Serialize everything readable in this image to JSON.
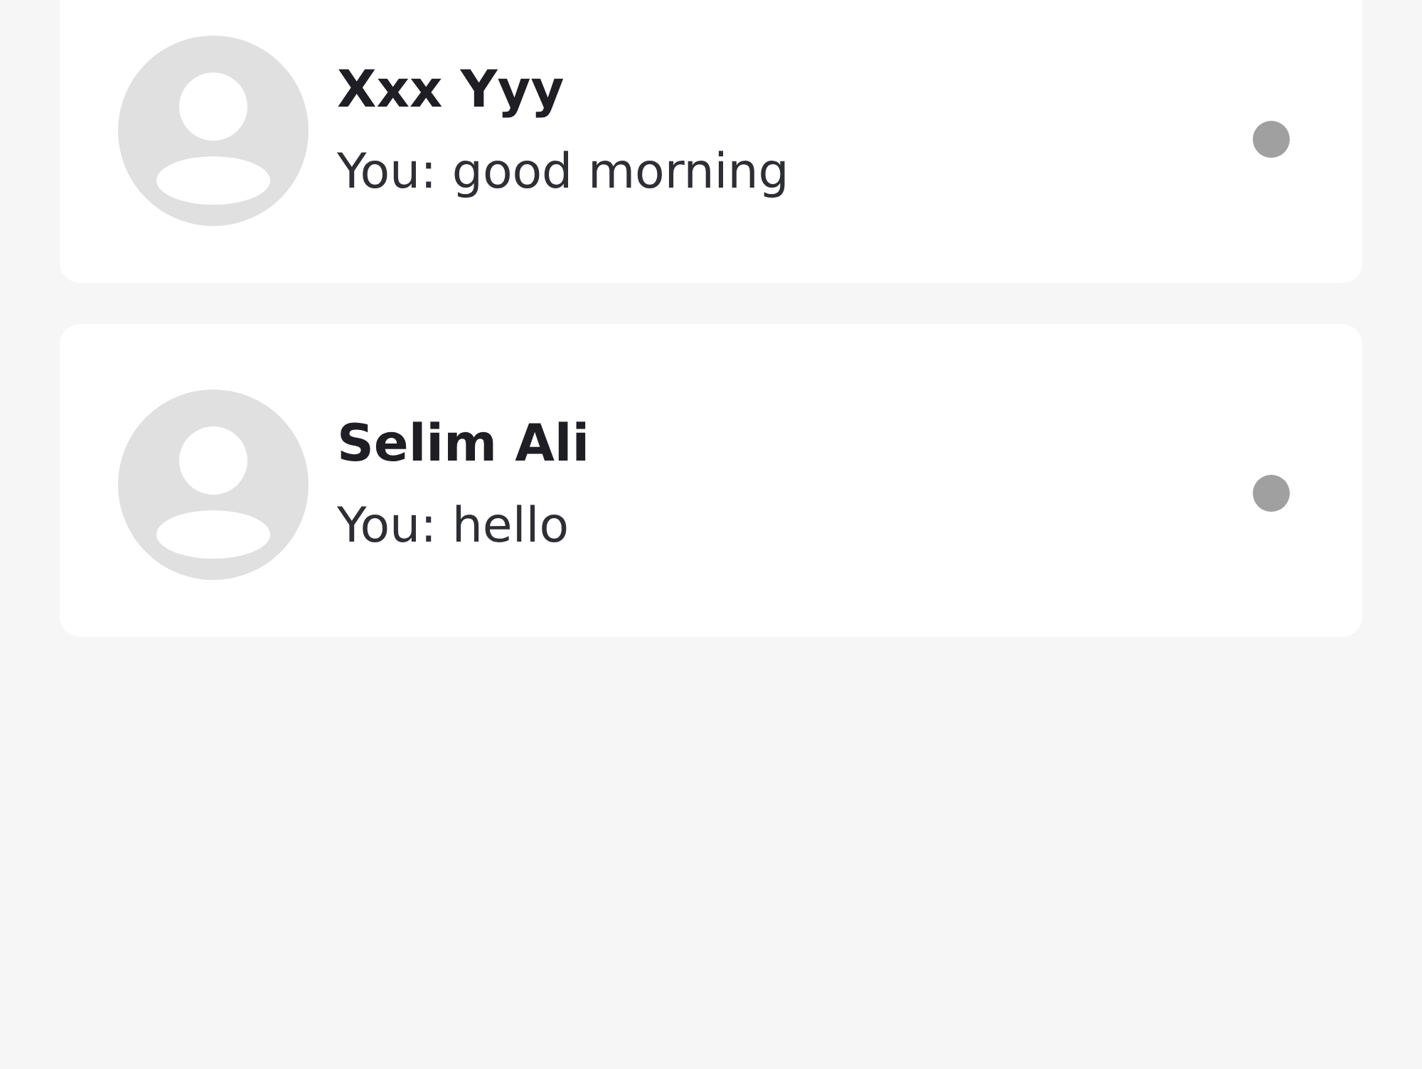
{
  "chats": [
    {
      "name": "Xxx Yyy",
      "last_message": "You: good morning",
      "online": false
    },
    {
      "name": "Selim Ali",
      "last_message": "You: hello",
      "online": false
    }
  ]
}
